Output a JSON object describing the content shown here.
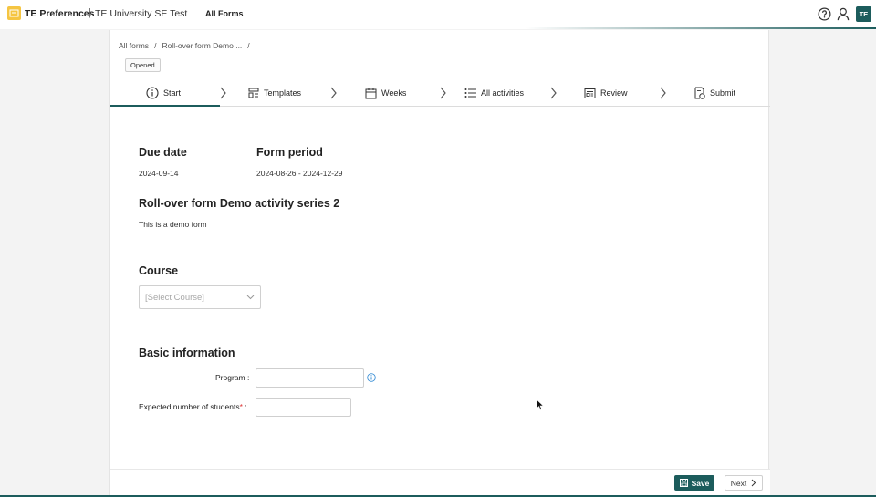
{
  "topbar": {
    "logo_icon": "app-logo-icon",
    "app_name": "TE Preferences",
    "separator": "|",
    "org_name": "TE University SE Test",
    "nav_all_forms": "All Forms",
    "avatar_initials": "TE",
    "accent_color": "#1c5c5c"
  },
  "breadcrumb": {
    "item1": "All forms",
    "sep1": "/",
    "item2": "Roll-over form Demo ...",
    "sep2": "/"
  },
  "status_badge": "Opened",
  "steps": [
    {
      "label": "Start",
      "icon": "info-circle-icon",
      "active": true
    },
    {
      "label": "Templates",
      "icon": "templates-icon",
      "active": false
    },
    {
      "label": "Weeks",
      "icon": "calendar-icon",
      "active": false
    },
    {
      "label": "All activities",
      "icon": "list-icon",
      "active": false
    },
    {
      "label": "Review",
      "icon": "review-icon",
      "active": false
    },
    {
      "label": "Submit",
      "icon": "submit-icon",
      "active": false
    }
  ],
  "form_info": {
    "due_date_label": "Due date",
    "due_date_value": "2024-09-14",
    "form_period_label": "Form period",
    "form_period_value": "2024-08-26 - 2024-12-29",
    "title": "Roll-over form Demo activity series 2",
    "description": "This is a demo form"
  },
  "course": {
    "heading": "Course",
    "placeholder": "[Select Course]"
  },
  "basic_info": {
    "heading": "Basic information",
    "program_label": "Program :",
    "expected_label": "Expected number of students",
    "required_mark": "*",
    "expected_colon": " :"
  },
  "footer": {
    "save_label": "Save",
    "next_label": "Next"
  }
}
